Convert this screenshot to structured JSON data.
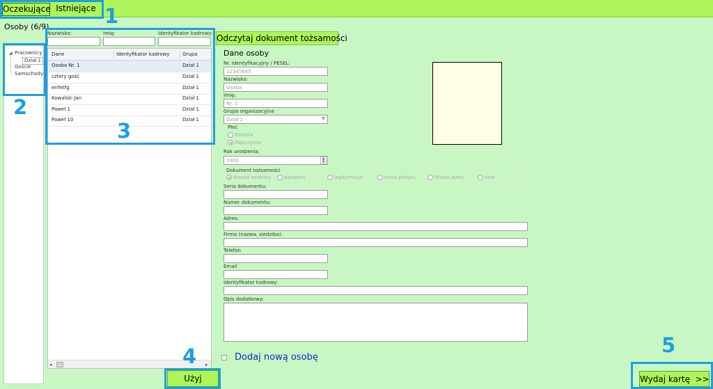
{
  "tabs": {
    "pending": "Oczekujące",
    "existing": "Istniejące"
  },
  "persons": {
    "header": "Osoby (6/9)",
    "filters": {
      "surname_label": "Nazwisko:",
      "first_name_label": "Imię:",
      "staff_id_label": "Identyfikator kadrowy:"
    },
    "tree": {
      "employees": "Pracownicy",
      "dept": "Dział 1",
      "guests": "Goście",
      "vehicles": "Samochody"
    },
    "columns": [
      "Dane",
      "Identyfikator kadrowy",
      "Grupa organiz"
    ],
    "rows": [
      {
        "name": "Osoba Nr. 1",
        "group": "Dział 1"
      },
      {
        "name": "cztery gość",
        "group": "Dział 1"
      },
      {
        "name": "erifetfg",
        "group": "Dział 1"
      },
      {
        "name": "Kowalski Jan",
        "group": "Dział 1"
      },
      {
        "name": "Paweł 1",
        "group": "Dział 1"
      },
      {
        "name": "Paweł 10",
        "group": "Dział 1"
      }
    ],
    "use_button": "Użyj"
  },
  "form": {
    "read_id_button": "Odczytaj dokument tożsamości",
    "section_title": "Dane osoby",
    "id_label": "Nr. Identyfikacyjny / PESEL:",
    "id_value": "12345665",
    "surname_label": "Nazwisko:",
    "surname_value": "Osoba",
    "first_name_label": "Imię:",
    "first_name_value": "Nr. 1",
    "group_label": "Grupa organizacyjna",
    "group_value": "Dział 1",
    "gender_label": "Płeć",
    "gender_female": "Kobieta",
    "gender_male": "Mężczyzna",
    "birth_year_label": "Rok urodzenia:",
    "birth_year_value": "1900",
    "document_label": "Dokument tożsamości",
    "doc_types": [
      "dowód osobisty",
      "paszport",
      "legitymacja",
      "karta pobytu",
      "Prawo jazdy",
      "inne"
    ],
    "doc_series_label": "Seria dokumentu:",
    "doc_number_label": "Numer dokumentu:",
    "address_label": "Adres:",
    "company_label": "Firma (nazwa, siedziba):",
    "phone_label": "Telefon",
    "email_label": "Email",
    "staff_id_label": "Identyfikator kadrowy:",
    "notes_label": "Opis dodatkowy:",
    "add_new_label": "Dodaj nową osobę",
    "issue_card_button": "Wydaj kartę  >>"
  },
  "annotations": [
    "1",
    "2",
    "3",
    "4",
    "5"
  ],
  "colors": {
    "background": "#c9f7c4",
    "top_bar": "#adf55a",
    "accent": "#1e9fe0"
  }
}
